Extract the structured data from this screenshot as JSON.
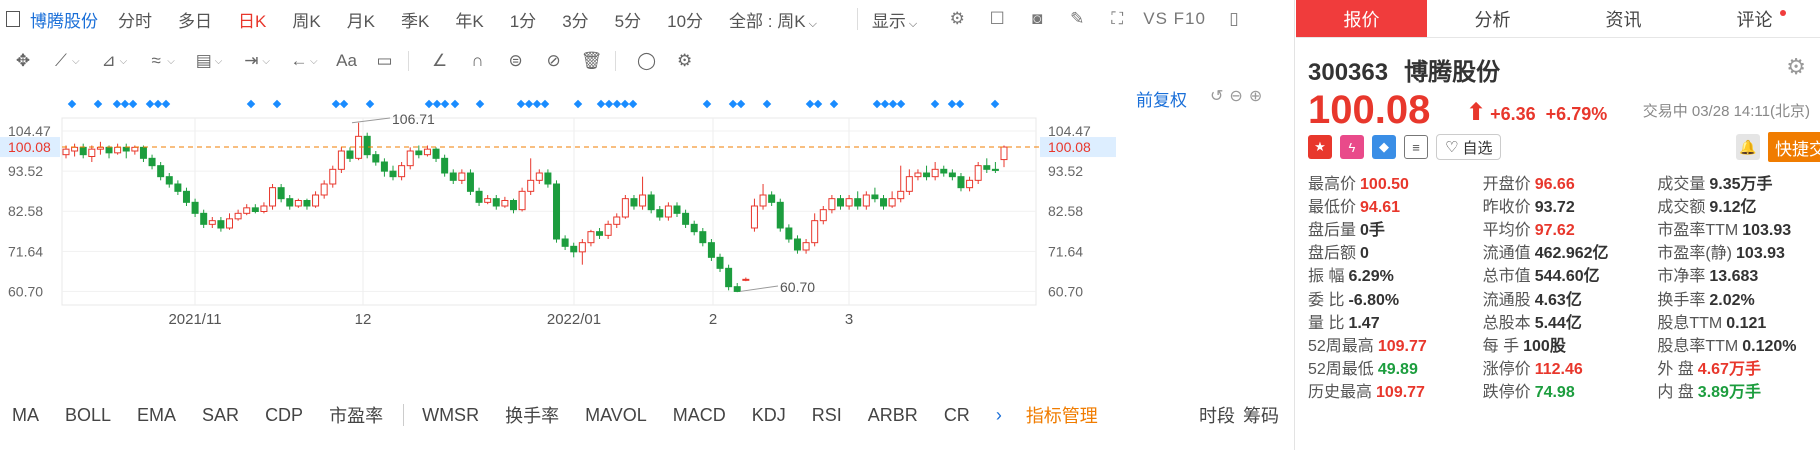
{
  "topbar": {
    "stock_name": "博腾股份",
    "tabs": [
      "分时",
      "多日",
      "日K",
      "周K",
      "月K",
      "季K",
      "年K",
      "1分",
      "3分",
      "5分",
      "10分"
    ],
    "active_tab": "日K",
    "all_select": "全部 : 周K",
    "display": "显示",
    "vs_f10": "VS F10"
  },
  "chart_header": {
    "fuquan": "前复权"
  },
  "chart": {
    "y_ticks": [
      "104.47",
      "93.52",
      "82.58",
      "71.64",
      "60.70"
    ],
    "current_price_label": "100.08",
    "x_ticks": [
      "2021/11",
      "12",
      "2022/01",
      "2",
      "3"
    ],
    "high_annotation": "106.71",
    "low_annotation": "60.70",
    "colors": {
      "up": "#e8372c",
      "down": "#1c9d3e",
      "price_line": "#f07c00",
      "marker": "#1a8cff"
    }
  },
  "indicators": {
    "items": [
      "MA",
      "BOLL",
      "EMA",
      "SAR",
      "CDP",
      "市盈率",
      "WMSR",
      "换手率",
      "MAVOL",
      "MACD",
      "KDJ",
      "RSI",
      "ARBR",
      "CR"
    ],
    "manage": "指标管理",
    "right_a": "时段",
    "right_b": "筹码"
  },
  "right": {
    "tabs": [
      "报价",
      "分析",
      "资讯",
      "评论"
    ],
    "code": "300363",
    "name": "博腾股份",
    "price": "100.08",
    "change": "+6.36",
    "change_pct": "+6.79%",
    "time": "交易中 03/28 14:11(北京)",
    "zixuan": "自选",
    "quick_trade": "快捷交易",
    "rows": [
      [
        {
          "l": "最高价",
          "v": "100.50",
          "c": "up"
        },
        {
          "l": "开盘价",
          "v": "96.66",
          "c": "up"
        },
        {
          "l": "成交量",
          "v": "9.35万手",
          "c": "nm"
        }
      ],
      [
        {
          "l": "最低价",
          "v": "94.61",
          "c": "up"
        },
        {
          "l": "昨收价",
          "v": "93.72",
          "c": "nm"
        },
        {
          "l": "成交额",
          "v": "9.12亿",
          "c": "nm"
        }
      ],
      [
        {
          "l": "盘后量",
          "v": "0手",
          "c": "nm"
        },
        {
          "l": "平均价",
          "v": "97.62",
          "c": "up"
        },
        {
          "l": "市盈率TTM",
          "v": "103.93",
          "c": "nm"
        }
      ],
      [
        {
          "l": "盘后额",
          "v": "0",
          "c": "nm"
        },
        {
          "l": "流通值",
          "v": "462.962亿",
          "c": "nm"
        },
        {
          "l": "市盈率(静)",
          "v": "103.93",
          "c": "nm"
        }
      ],
      [
        {
          "l": "振 幅",
          "v": "6.29%",
          "c": "nm"
        },
        {
          "l": "总市值",
          "v": "544.60亿",
          "c": "nm"
        },
        {
          "l": "市净率",
          "v": "13.683",
          "c": "nm"
        }
      ],
      [
        {
          "l": "委 比",
          "v": "-6.80%",
          "c": "nm"
        },
        {
          "l": "流通股",
          "v": "4.63亿",
          "c": "nm"
        },
        {
          "l": "换手率",
          "v": "2.02%",
          "c": "nm"
        }
      ],
      [
        {
          "l": "量 比",
          "v": "1.47",
          "c": "nm"
        },
        {
          "l": "总股本",
          "v": "5.44亿",
          "c": "nm"
        },
        {
          "l": "股息TTM",
          "v": "0.121",
          "c": "nm"
        }
      ],
      [
        {
          "l": "52周最高",
          "v": "109.77",
          "c": "up"
        },
        {
          "l": "每 手",
          "v": "100股",
          "c": "nm"
        },
        {
          "l": "股息率TTM",
          "v": "0.120%",
          "c": "nm"
        }
      ],
      [
        {
          "l": "52周最低",
          "v": "49.89",
          "c": "dn"
        },
        {
          "l": "涨停价",
          "v": "112.46",
          "c": "up"
        },
        {
          "l": "外 盘",
          "v": "4.67万手",
          "c": "up"
        }
      ],
      [
        {
          "l": "历史最高",
          "v": "109.77",
          "c": "up"
        },
        {
          "l": "跌停价",
          "v": "74.98",
          "c": "dn"
        },
        {
          "l": "内 盘",
          "v": "3.89万手",
          "c": "dn"
        }
      ]
    ]
  }
}
